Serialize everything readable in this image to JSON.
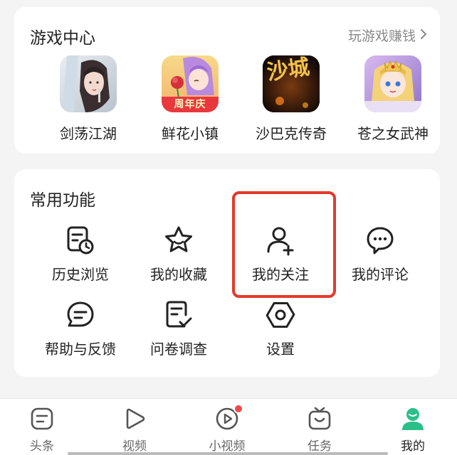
{
  "colors": {
    "accent_green": "#2bbf8a",
    "highlight_red": "#e4392c",
    "badge_red": "#f04a4a",
    "muted_text": "#8a8a8a"
  },
  "games": {
    "title": "游戏中心",
    "more_label": "玩游戏赚钱",
    "more_icon": "chevron-right-icon",
    "items": [
      {
        "name": "剑荡江湖"
      },
      {
        "name": "鲜花小镇",
        "badge": "周年庆"
      },
      {
        "name": "沙巴克传奇",
        "art_text": "沙城"
      },
      {
        "name": "苍之女武神"
      }
    ]
  },
  "functions": {
    "title": "常用功能",
    "items": [
      {
        "label": "历史浏览",
        "icon": "history-clock-icon"
      },
      {
        "label": "我的收藏",
        "icon": "star-icon"
      },
      {
        "label": "我的关注",
        "icon": "user-plus-icon"
      },
      {
        "label": "我的评论",
        "icon": "comment-bubble-icon"
      },
      {
        "label": "帮助与反馈",
        "icon": "feedback-bubble-icon"
      },
      {
        "label": "问卷调查",
        "icon": "survey-check-icon"
      },
      {
        "label": "设置",
        "icon": "settings-hexagon-icon"
      }
    ]
  },
  "tabbar": {
    "items": [
      {
        "label": "头条",
        "icon": "headline-icon",
        "active": false
      },
      {
        "label": "视频",
        "icon": "play-icon",
        "active": false
      },
      {
        "label": "小视频",
        "icon": "short-video-icon",
        "active": false,
        "has_dot": true
      },
      {
        "label": "任务",
        "icon": "task-tv-icon",
        "active": false
      },
      {
        "label": "我的",
        "icon": "profile-icon",
        "active": true
      }
    ]
  }
}
